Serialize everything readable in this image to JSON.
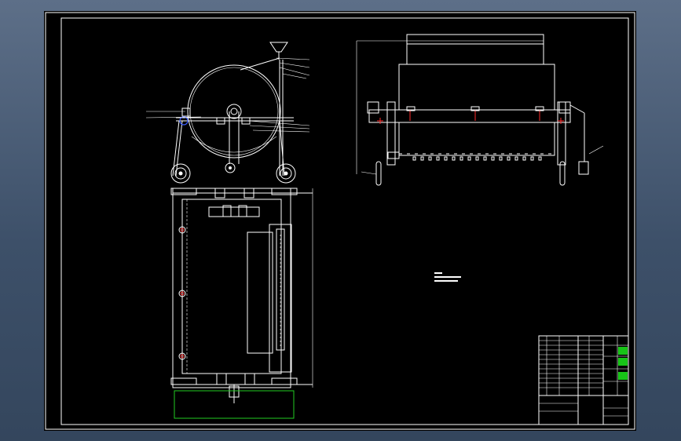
{
  "drawing": {
    "tech_notes": [
      "",
      "",
      ""
    ]
  },
  "title_block": {
    "cells": [
      "",
      "",
      "",
      "",
      "",
      "",
      ""
    ]
  },
  "colors": {
    "background": "#3b4e66",
    "paper": "#000000",
    "lines": "#ffffff",
    "center_marks": "#ff2a2a",
    "outline_green": "#22cc22",
    "highlight": "#17c417",
    "accent_blue": "#3a5cff"
  }
}
